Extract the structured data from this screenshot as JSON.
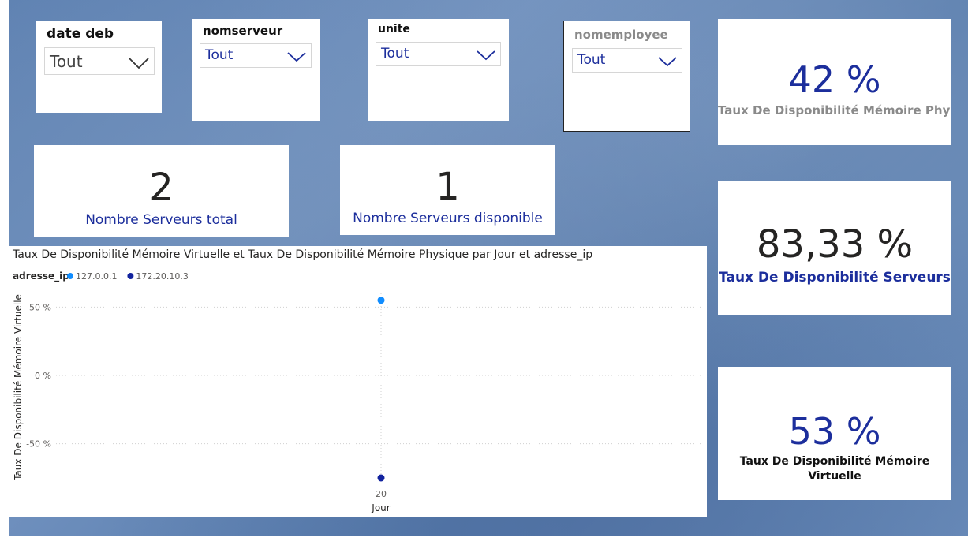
{
  "colors": {
    "accent": "#1c2e9c",
    "dark_text": "#252423",
    "gray_text": "#8a8a8a",
    "series1": "#118dff",
    "series2": "#12239e"
  },
  "slicers": [
    {
      "title": "date deb",
      "value": "Tout"
    },
    {
      "title": "nomserveur",
      "value": "Tout"
    },
    {
      "title": "unite",
      "value": "Tout"
    },
    {
      "title": "nomemployee",
      "value": "Tout"
    }
  ],
  "cards": {
    "total_servers": {
      "value": "2",
      "label": "Nombre Serveurs total"
    },
    "available_servers": {
      "value": "1",
      "label": "Nombre Serveurs disponible"
    },
    "phys_mem": {
      "value": "42 %",
      "label": "Taux De Disponibilité Mémoire Physi..."
    },
    "server_avail": {
      "value": "83,33 %",
      "label": "Taux De Disponibilité Serveurs"
    },
    "virt_mem": {
      "value": "53 %",
      "label_line1": "Taux De Disponibilité Mémoire",
      "label_line2": "Virtuelle"
    }
  },
  "chart": {
    "title": "Taux De Disponibilité Mémoire Virtuelle et Taux De Disponibilité Mémoire Physique par Jour et adresse_ip",
    "legend_title": "adresse_ip"
  },
  "chart_data": {
    "type": "scatter",
    "title": "Taux De Disponibilité Mémoire Virtuelle et Taux De Disponibilité Mémoire Physique par Jour et adresse_ip",
    "xlabel": "Jour",
    "ylabel": "Taux De Disponibilité Mémoire Virtuelle",
    "x_ticks": [
      "20"
    ],
    "y_ticks": [
      "50 %",
      "0 %",
      "-50 %"
    ],
    "y_tick_values": [
      50,
      0,
      -50
    ],
    "ylim": [
      -75,
      60
    ],
    "legend_position": "top-left",
    "grid": true,
    "series": [
      {
        "name": "127.0.0.1",
        "color": "#118dff",
        "points": [
          {
            "x": 20,
            "y": 55
          }
        ]
      },
      {
        "name": "172.20.10.3",
        "color": "#12239e",
        "points": [
          {
            "x": 20,
            "y": -75
          }
        ]
      }
    ]
  }
}
